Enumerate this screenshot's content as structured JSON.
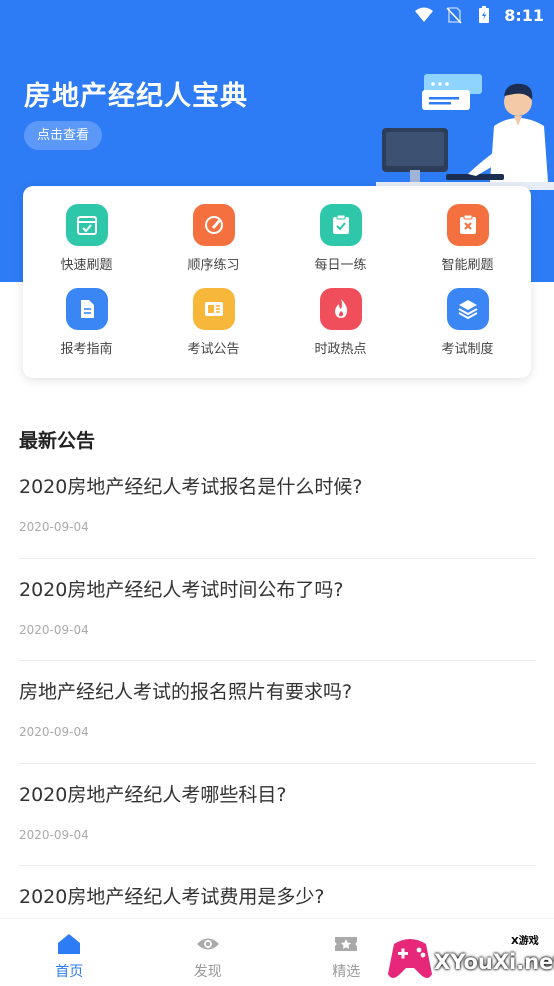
{
  "status_bar": {
    "time": "8:11",
    "icons": [
      "wifi-icon",
      "no-sim-icon",
      "battery-icon"
    ]
  },
  "hero": {
    "title": "房地产经纪人宝典",
    "button": "点击查看",
    "accent": "#2d7cf6"
  },
  "features": [
    {
      "label": "快速刷题",
      "icon": "calendar-check-icon",
      "color": "#2ec7a9"
    },
    {
      "label": "顺序练习",
      "icon": "pencil-icon",
      "color": "#f5703f"
    },
    {
      "label": "每日一练",
      "icon": "clipboard-check-icon",
      "color": "#2ec7a9"
    },
    {
      "label": "智能刷题",
      "icon": "clipboard-x-icon",
      "color": "#f5703f"
    },
    {
      "label": "报考指南",
      "icon": "document-icon",
      "color": "#3a86f5"
    },
    {
      "label": "考试公告",
      "icon": "notice-icon",
      "color": "#f7b73a"
    },
    {
      "label": "时政热点",
      "icon": "flame-icon",
      "color": "#f04e5b"
    },
    {
      "label": "考试制度",
      "icon": "layers-icon",
      "color": "#3a86f5"
    }
  ],
  "news": {
    "section_title": "最新公告",
    "items": [
      {
        "title": "2020房地产经纪人考试报名是什么时候?",
        "date": "2020-09-04"
      },
      {
        "title": "2020房地产经纪人考试时间公布了吗?",
        "date": "2020-09-04"
      },
      {
        "title": "房地产经纪人考试的报名照片有要求吗?",
        "date": "2020-09-04"
      },
      {
        "title": "2020房地产经纪人考哪些科目?",
        "date": "2020-09-04"
      },
      {
        "title": "2020房地产经纪人考试费用是多少?",
        "date": ""
      }
    ]
  },
  "tabs": [
    {
      "label": "首页",
      "icon": "home-icon",
      "active": true
    },
    {
      "label": "发现",
      "icon": "eye-icon",
      "active": false
    },
    {
      "label": "精选",
      "icon": "ticket-icon",
      "active": false
    },
    {
      "label": "",
      "icon": "",
      "active": false
    }
  ],
  "watermark": {
    "text": "XYouXi.net",
    "small": "X游戏"
  }
}
